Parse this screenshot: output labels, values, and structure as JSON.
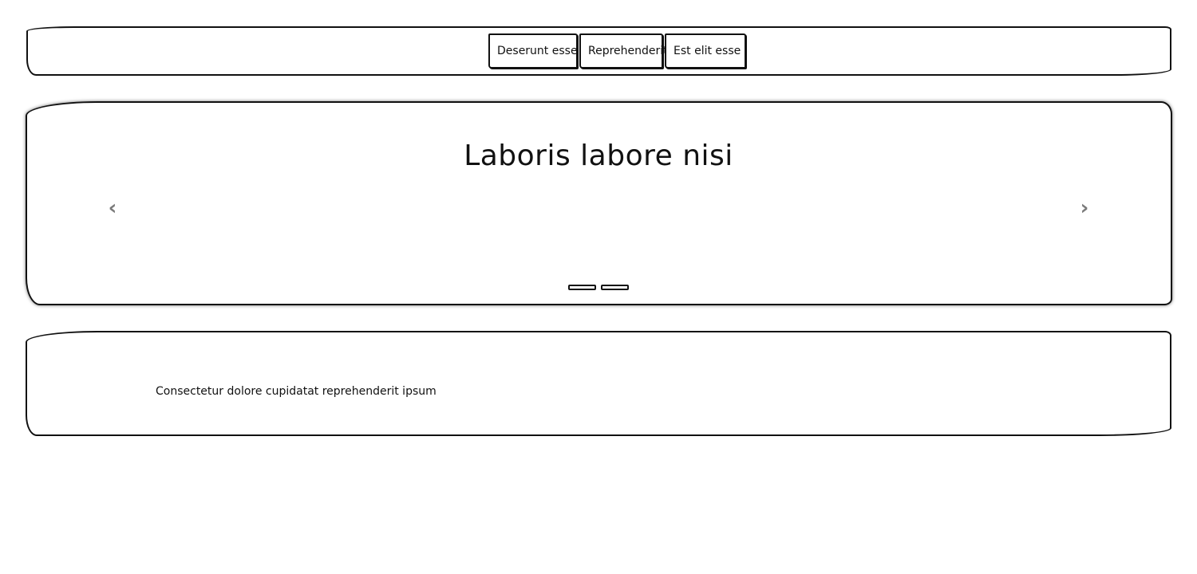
{
  "nav": {
    "items": [
      {
        "label": "Deserunt esse"
      },
      {
        "label": "Reprehenderit"
      },
      {
        "label": "Est elit esse"
      }
    ]
  },
  "carousel": {
    "title": "Laboris labore nisi",
    "prev_icon": "chevron-left-icon",
    "next_icon": "chevron-right-icon",
    "prev_glyph": "‹",
    "next_glyph": "›",
    "indicator_count": 2,
    "arrow_color": "#7a7a7a"
  },
  "content": {
    "text": "Consectetur dolore cupidatat reprehenderit ipsum"
  }
}
